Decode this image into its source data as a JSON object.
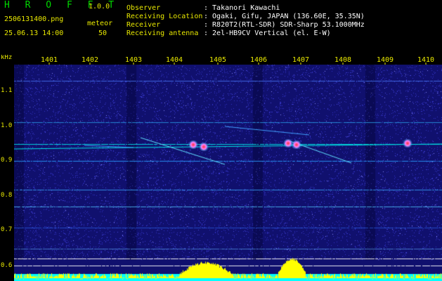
{
  "header": {
    "title": "H R O F F T",
    "version": "1.0.0",
    "filename": "2506131400.png",
    "datetime": "25.06.13 14:00",
    "meteor_label": "meteor",
    "meteor_count": "50",
    "fields": [
      {
        "label": "Observer",
        "value": ": Takanori Kawachi"
      },
      {
        "label": "Receiving Location",
        "value": ": Ogaki, Gifu, JAPAN (136.60E, 35.35N)"
      },
      {
        "label": "Receiver",
        "value": ": R820T2(RTL-SDR) SDR-Sharp 53.1000MHz"
      },
      {
        "label": "Receiving antenna",
        "value": ": 2el-HB9CV Vertical (el. E-W)"
      }
    ]
  },
  "axes": {
    "freq_unit": "kHz",
    "time_ticks": [
      "1401",
      "1402",
      "1403",
      "1404",
      "1405",
      "1406",
      "1407",
      "1408",
      "1409",
      "1410"
    ],
    "freq_ticks": [
      "1.1",
      "1.0",
      "0.9",
      "0.8",
      "0.7",
      "0.6"
    ]
  },
  "colors": {
    "background": "#000000",
    "title_green": "#00d800",
    "label_yellow": "#e8e800",
    "text_white": "#ffffff",
    "waterfall_bg": "#10106e",
    "noise": "#3535c8",
    "signal": "#00e6e6",
    "hot": "#ff3030",
    "level_bar": "#ffff00",
    "level_base": "#00ffff"
  }
}
